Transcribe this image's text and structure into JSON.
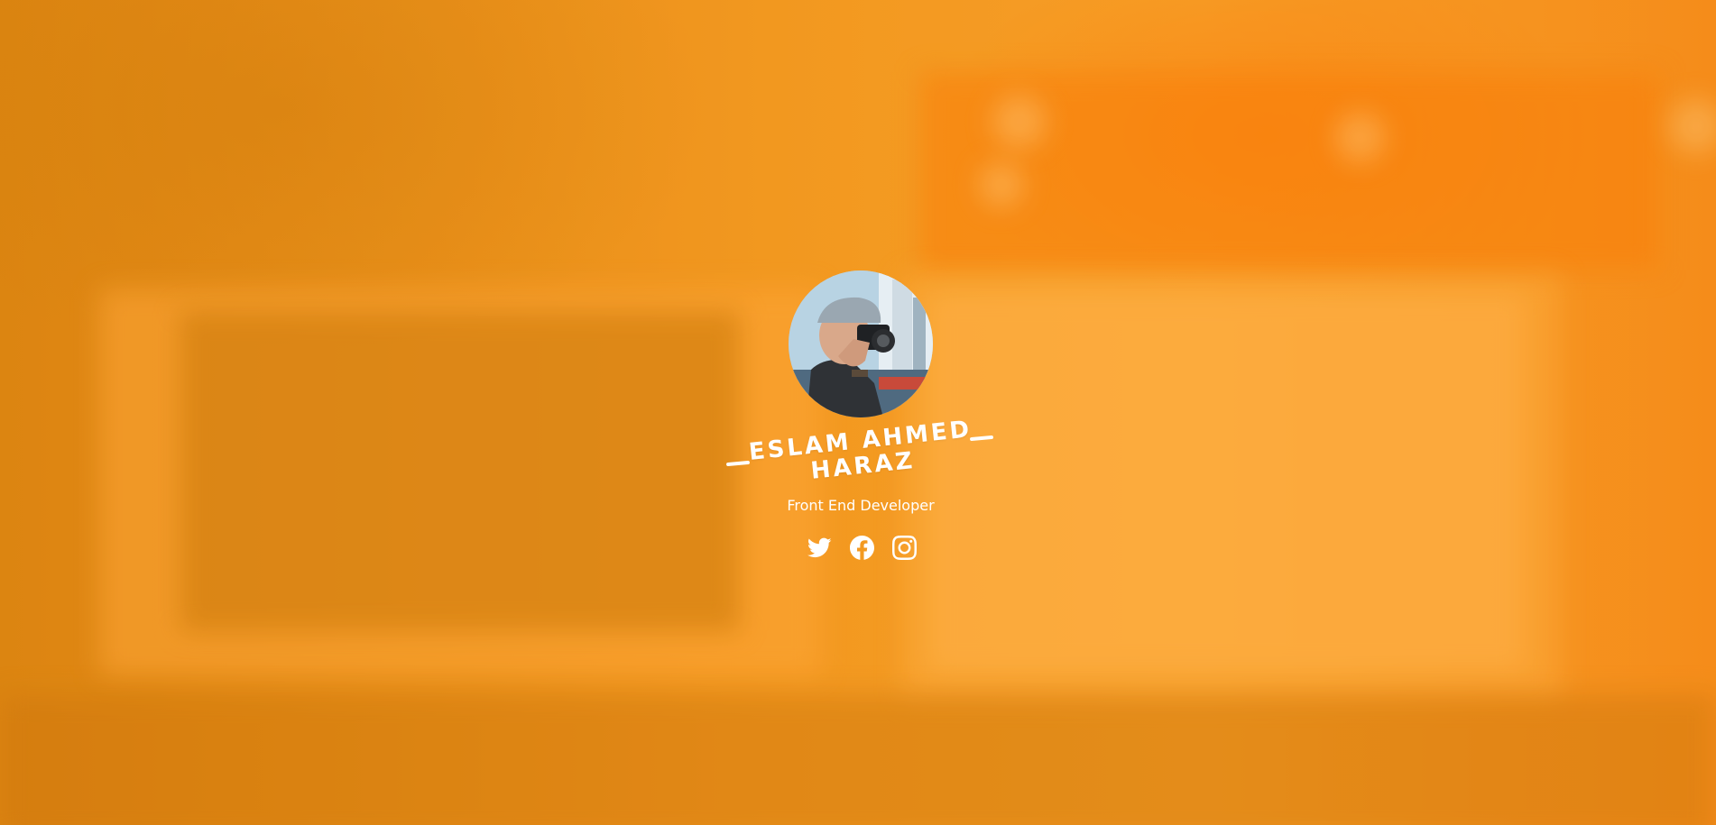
{
  "profile": {
    "name_line1": "ESLAM AHMED",
    "name_line2": "HARAZ",
    "role": "Front End Developer"
  },
  "socials": [
    {
      "network": "twitter",
      "icon": "twitter-icon"
    },
    {
      "network": "facebook",
      "icon": "facebook-icon"
    },
    {
      "network": "instagram",
      "icon": "instagram-icon"
    }
  ],
  "theme": {
    "accent": "#f39a22",
    "text": "#ffffff"
  }
}
